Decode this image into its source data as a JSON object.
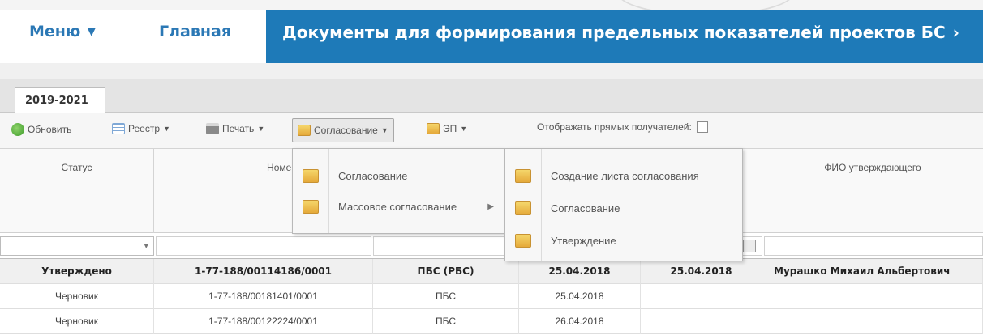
{
  "header": {
    "menu_label": "Меню",
    "home_label": "Главная",
    "title": "Документы для формирования предельных показателей проектов БС",
    "title_arrow": "›"
  },
  "tabs": [
    {
      "label": "2019-2021",
      "active": true
    }
  ],
  "toolbar": {
    "refresh": "Обновить",
    "registry": "Реестр",
    "print": "Печать",
    "approval": "Согласование",
    "ep": "ЭП",
    "direct_recipients": "Отображать прямых получателей:",
    "direct_recipients_checked": false
  },
  "columns": {
    "status": "Статус",
    "number": "Номер",
    "approver_fio": "ФИО утверждающего"
  },
  "approval_menu": {
    "items": [
      {
        "label": "Согласование",
        "has_submenu": false
      },
      {
        "label": "Массовое согласование",
        "has_submenu": true
      }
    ]
  },
  "mass_approval_submenu": {
    "items": [
      {
        "label": "Создание листа согласования"
      },
      {
        "label": "Согласование"
      },
      {
        "label": "Утверждение"
      }
    ]
  },
  "rows": [
    {
      "status": "Утверждено",
      "number": "1-77-188/00114186/0001",
      "type": "ПБС (РБС)",
      "date1": "25.04.2018",
      "date2": "25.04.2018",
      "fio": "Мурашко Михаил Альбертович",
      "selected": true
    },
    {
      "status": "Черновик",
      "number": "1-77-188/00181401/0001",
      "type": "ПБС",
      "date1": "25.04.2018",
      "date2": "",
      "fio": "",
      "selected": false
    },
    {
      "status": "Черновик",
      "number": "1-77-188/00122224/0001",
      "type": "ПБС",
      "date1": "26.04.2018",
      "date2": "",
      "fio": "",
      "selected": false
    }
  ],
  "icons": {
    "refresh": "refresh-icon",
    "registry": "table-icon",
    "print": "printer-icon",
    "approval": "folder-icon",
    "ep": "folder-icon"
  },
  "colors": {
    "accent": "#1e7ab8",
    "link": "#2b78b5"
  }
}
